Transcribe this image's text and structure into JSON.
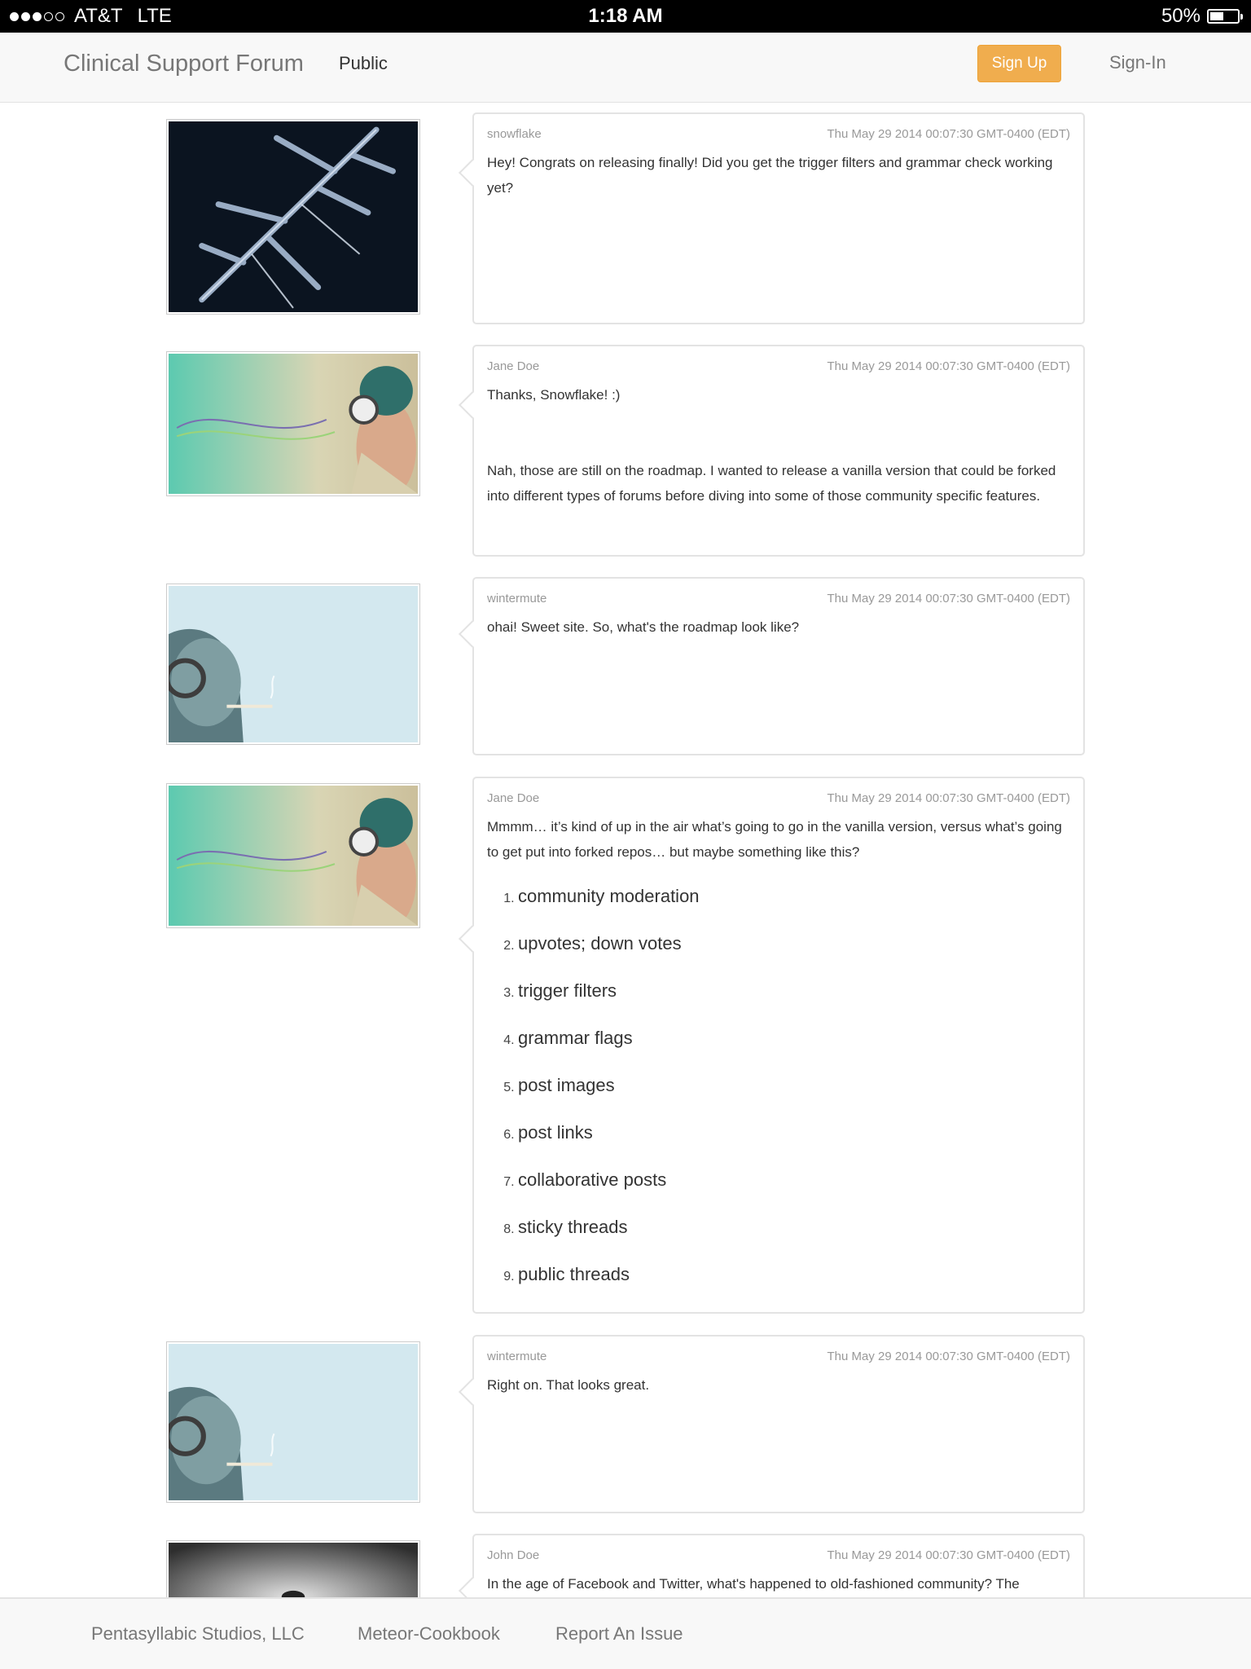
{
  "status_bar": {
    "carrier": "AT&T",
    "network": "LTE",
    "time": "1:18 AM",
    "battery": "50%",
    "battery_level": 0.5,
    "signal_bars": 3
  },
  "navbar": {
    "brand": "Clinical Support Forum",
    "public_link": "Public",
    "signup_label": "Sign Up",
    "signin_label": "Sign-In",
    "signup_color": "#f0ad4e"
  },
  "posts": [
    {
      "author": "snowflake",
      "timestamp": "Thu May 29 2014 00:07:30 GMT-0400 (EDT)",
      "avatar": "snowflake-image",
      "paragraphs": [
        "Hey!  Congrats on releasing finally!  Did you get the trigger filters and grammar check working yet?"
      ]
    },
    {
      "author": "Jane Doe",
      "timestamp": "Thu May 29 2014 00:07:30 GMT-0400 (EDT)",
      "avatar": "headphones-woman-image",
      "paragraphs": [
        "Thanks, Snowflake!  :)",
        "Nah, those are still on the roadmap.  I wanted to release a vanilla version that could be forked into different types of forums before diving into some of those community specific features."
      ]
    },
    {
      "author": "wintermute",
      "timestamp": "Thu May 29 2014 00:07:30 GMT-0400 (EDT)",
      "avatar": "headphones-character-image",
      "paragraphs": [
        "ohai!  Sweet site.   So, what's the roadmap look like?"
      ]
    },
    {
      "author": "Jane Doe",
      "timestamp": "Thu May 29 2014 00:07:30 GMT-0400 (EDT)",
      "avatar": "headphones-woman-image",
      "paragraphs": [
        "Mmmm…  it’s kind of up in the air what’s going to go in the vanilla version, versus what’s going to get put into forked repos…  but maybe something like this?"
      ],
      "list": [
        "community moderation",
        "upvotes; down votes",
        "trigger filters",
        "grammar flags",
        "post images",
        "post links",
        "collaborative posts",
        "sticky threads",
        "public threads"
      ]
    },
    {
      "author": "wintermute",
      "timestamp": "Thu May 29 2014 00:07:30 GMT-0400 (EDT)",
      "avatar": "headphones-character-image",
      "paragraphs": [
        "Right on.  That looks great."
      ]
    },
    {
      "author": "John Doe",
      "timestamp": "Thu May 29 2014 00:07:30 GMT-0400 (EDT)",
      "avatar": "storm-cloud-image",
      "paragraphs": [
        "In the age of Facebook and Twitter, what's happened to old-fashioned community?  The"
      ]
    }
  ],
  "footer": {
    "links": [
      "Pentasyllabic Studios, LLC",
      "Meteor-Cookbook",
      "Report An Issue"
    ]
  }
}
